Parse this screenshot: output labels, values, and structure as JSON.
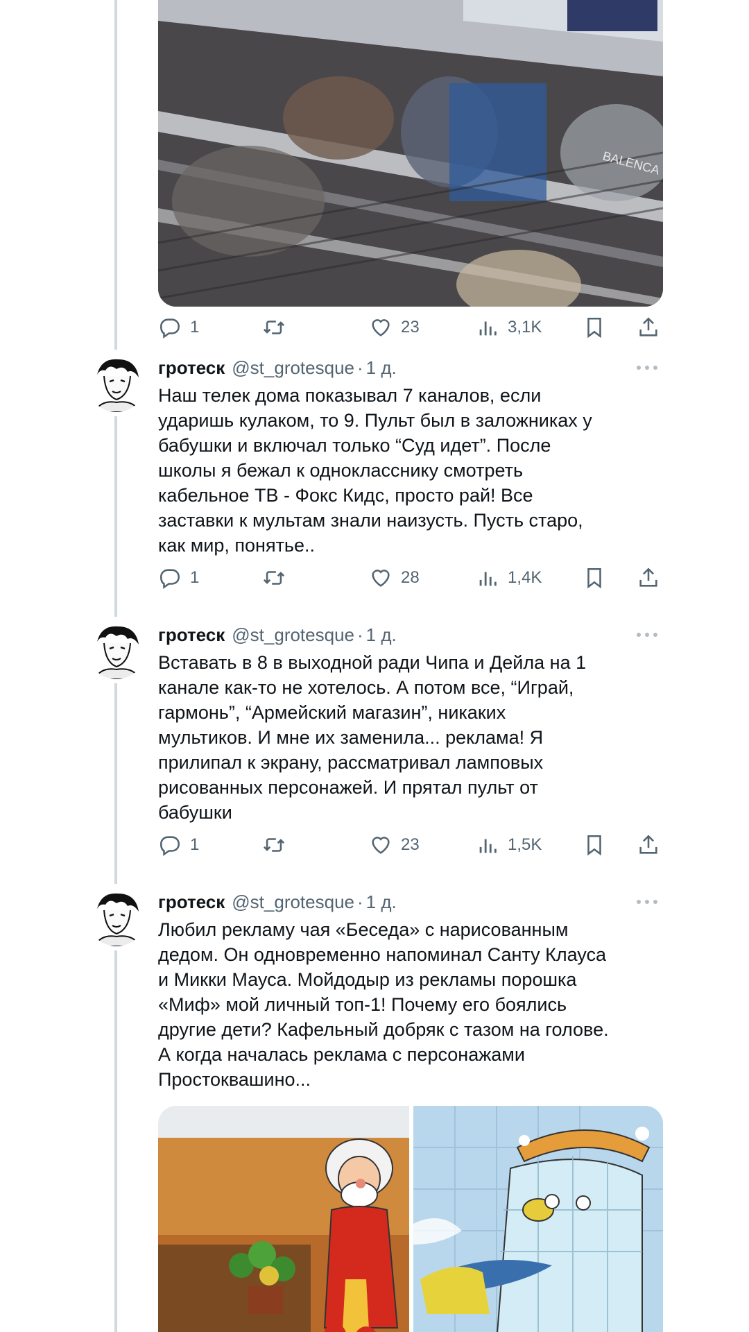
{
  "colors": {
    "text": "#0f1419",
    "secondary": "#536471",
    "thread_line": "#cfd9de",
    "background": "#ffffff"
  },
  "top_post": {
    "stats": {
      "replies": "1",
      "likes": "23",
      "views": "3,1K"
    },
    "media_overlay_text": "BALENCA"
  },
  "tweets": [
    {
      "name": "гротеск",
      "handle": "@st_grotesque",
      "time": "1 д.",
      "text": "Наш телек дома показывал 7 каналов, если\nударишь кулаком, то 9. Пульт был в заложниках у\nбабушки и включал только “Суд идет”. После\nшколы я бежал к однокласснику смотреть\nкабельное ТВ - Фокс Кидс, просто рай! Все\nзаставки к мультам знали наизусть. Пусть старо,\nкак мир, понятье..",
      "stats": {
        "replies": "1",
        "likes": "28",
        "views": "1,4K"
      }
    },
    {
      "name": "гротеск",
      "handle": "@st_grotesque",
      "time": "1 д.",
      "text": "Вставать в 8 в выходной ради Чипа и Дейла на 1\nканале как-то не хотелось. А потом все, “Играй,\nгармонь”, “Армейский магазин”, никаких\nмультиков. И мне их заменила... реклама! Я\nприлипал к экрану, рассматривал ламповых\nрисованных персонажей. И прятал пульт от\nбабушки",
      "stats": {
        "replies": "1",
        "likes": "23",
        "views": "1,5K"
      }
    },
    {
      "name": "гротеск",
      "handle": "@st_grotesque",
      "time": "1 д.",
      "text": "Любил рекламу чая «Беседа» с нарисованным\nдедом. Он одновременно напоминал Санту Клауса\nи Микки Мауса. Мойдодыр из рекламы порошка\n«Миф» мой личный топ-1! Почему его боялись\nдругие дети? Кафельный добряк с тазом на голове.\nА когда началась реклама с персонажами\nПростоквашино..."
    }
  ],
  "icons": {
    "reply": "reply-icon",
    "retweet": "retweet-icon",
    "like": "like-icon",
    "views": "views-icon",
    "bookmark": "bookmark-icon",
    "share": "share-icon",
    "more": "more-icon",
    "avatar": "avatar-image"
  }
}
